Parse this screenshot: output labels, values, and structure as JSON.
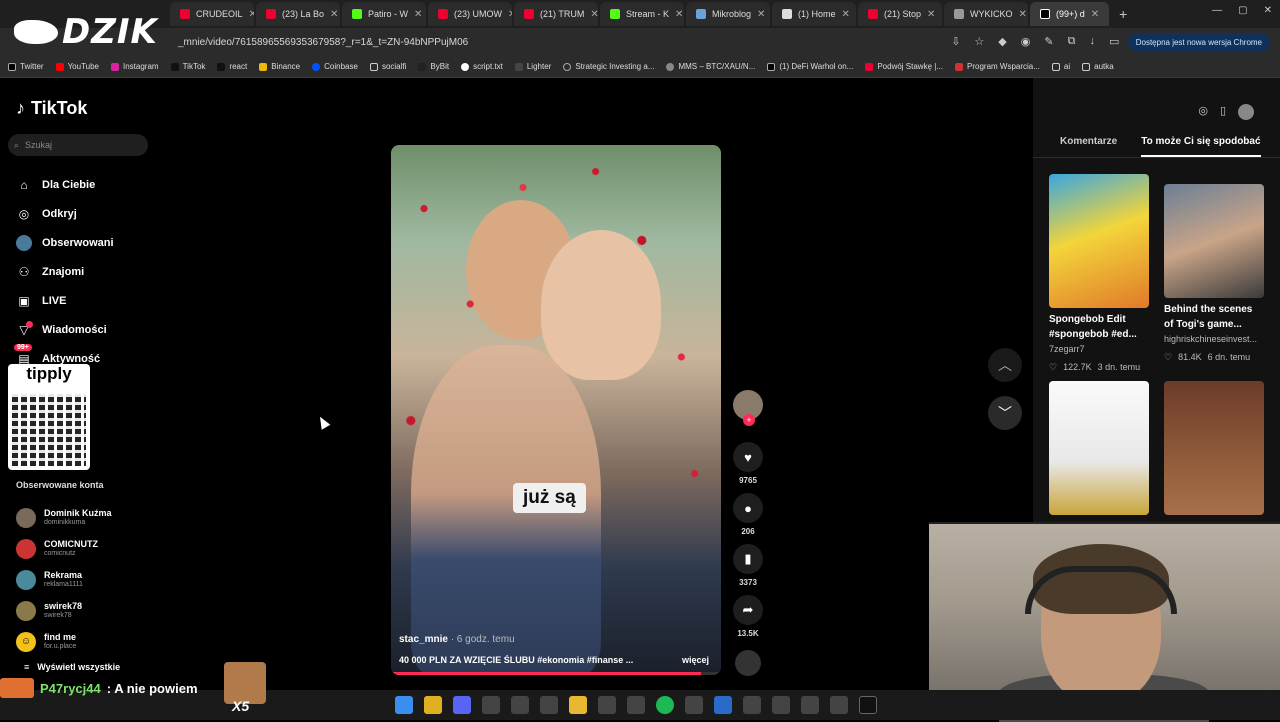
{
  "browser": {
    "tabs": [
      {
        "label": "CRUDEOIL"
      },
      {
        "label": "(23) La Bo"
      },
      {
        "label": "Patiro - W"
      },
      {
        "label": "(23) UMOW"
      },
      {
        "label": "(21) TRUM"
      },
      {
        "label": "Stream - K"
      },
      {
        "label": "Mikroblog"
      },
      {
        "label": "(1) Home"
      },
      {
        "label": "(21) Stop"
      },
      {
        "label": "WYKICKO"
      },
      {
        "label": "(99+) d",
        "active": true
      }
    ],
    "url": "_mnie/video/7615896556935367958?_r=1&_t=ZN-94bNPPujM06",
    "update_button": "Dostępna jest nowa wersja Chrome",
    "bookmarks": [
      "Twitter",
      "YouTube",
      "Instagram",
      "TikTok",
      "react",
      "Binance",
      "Coinbase",
      "socialfi",
      "ByBit",
      "script.txt",
      "Lighter",
      "Strategic Investing a...",
      "MMS – BTC/XAU/N...",
      "(1) DeFi Warhol on...",
      "Podwój Stawkę |...",
      "Program Wsparcia...",
      "ai",
      "autka"
    ]
  },
  "overlay": {
    "brand": "DZIK"
  },
  "sidebar": {
    "logo": "TikTok",
    "search_placeholder": "Szukaj",
    "nav": [
      {
        "label": "Dla Ciebie",
        "icon": "home-icon"
      },
      {
        "label": "Odkryj",
        "icon": "compass-icon"
      },
      {
        "label": "Obserwowani",
        "icon": "avatar-icon"
      },
      {
        "label": "Znajomi",
        "icon": "friends-icon"
      },
      {
        "label": "LIVE",
        "icon": "live-icon"
      },
      {
        "label": "Wiadomości",
        "icon": "message-icon",
        "badge": "9"
      },
      {
        "label": "Aktywność",
        "icon": "inbox-icon",
        "badge": "99+"
      }
    ],
    "tipply_label": "tipply",
    "following_title": "Obserwowane konta",
    "accounts": [
      {
        "name": "Dominik Kuźma",
        "handle": "dominikkuma"
      },
      {
        "name": "COMICNUTZ",
        "handle": "comicnutz"
      },
      {
        "name": "Rekrama",
        "handle": "reklama1111"
      },
      {
        "name": "swirek78",
        "handle": "swirek78"
      },
      {
        "name": "find me",
        "handle": "for.u.place"
      }
    ],
    "show_all": "Wyświetl wszystkie"
  },
  "video": {
    "caption_overlay": "już są",
    "author": "stac_mnie",
    "time": "· 6 godz. temu",
    "description": "40 000 PLN ZA WZIĘCIE ŚLUBU #ekonomia #finanse ...",
    "more": "więcej",
    "progress": 0.94
  },
  "actions": {
    "likes": "9765",
    "comments": "206",
    "saves": "3373",
    "shares": "13.5K"
  },
  "right_panel": {
    "tabs": [
      {
        "label": "Komentarze"
      },
      {
        "label": "To może Ci się spodobać",
        "active": true
      }
    ],
    "cards": [
      {
        "title": "Spongebob Edit #spongebob #ed...",
        "author": "7zegarr7",
        "likes": "122.7K",
        "time": "3 dn. temu"
      },
      {
        "title": "Behind the scenes of Togi's game...",
        "author": "highriskchineseinvest...",
        "likes": "81.4K",
        "time": "6 dn. temu"
      },
      {
        "title": "",
        "author": "",
        "likes": "",
        "time": ""
      },
      {
        "title": "",
        "author": "",
        "likes": "",
        "time": ""
      }
    ]
  },
  "stream": {
    "chat_user": "P47rycj44",
    "chat_message": ": A nie powiem",
    "emote_multiplier": "X5"
  },
  "colors": {
    "accent": "#fe2c55",
    "background": "#000000",
    "chat_user": "#7ee36b"
  }
}
